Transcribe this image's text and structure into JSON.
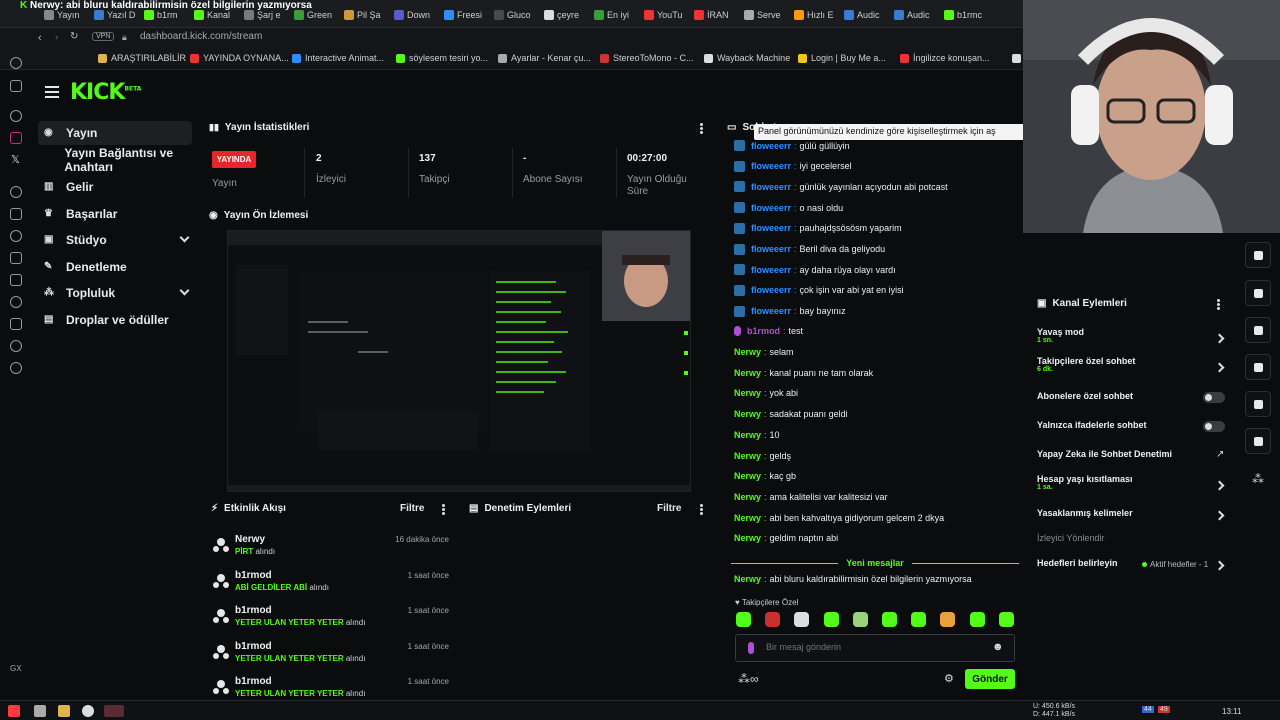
{
  "browser": {
    "window_title": "Nerwy: abi bluru kaldırabilirmisin özel bilgilerin yazmıyorsa",
    "tabs": [
      "Yayın",
      "Yazıl D",
      "b1rm",
      "Kanal",
      "Şarj e",
      "Green",
      "Pil Şa",
      "Down",
      "Freesi",
      "Gluco",
      "çeyre",
      "En iyi",
      "YouTu",
      "İRAN",
      "Serve",
      "Hızlı E",
      "Audic",
      "Audic",
      "b1rmc"
    ],
    "url": "dashboard.kick.com/stream",
    "vpn_label": "VPN",
    "bookmarks": [
      "ARAŞTIRILABİLİR",
      "YAYINDA OYNANA...",
      "Interactive Animat...",
      "söylesem tesiri yo...",
      "Ayarlar - Kenar çu...",
      "StereoToMono - C...",
      "Wayback Machine",
      "Login | Buy Me a...",
      "İngilizce konuşan...",
      "S"
    ],
    "sidebar_bottom_label": "GX"
  },
  "app": {
    "logo": "KICK",
    "logo_badge": "BETA"
  },
  "nav": {
    "items": [
      {
        "label": "Yayın",
        "icon": "stream-icon"
      },
      {
        "label": "Yayın Bağlantısı ve Anahtarı",
        "icon": "key-icon"
      },
      {
        "label": "Gelir",
        "icon": "chart-icon"
      },
      {
        "label": "Başarılar",
        "icon": "trophy-icon"
      },
      {
        "label": "Stüdyo",
        "icon": "studio-icon"
      },
      {
        "label": "Denetleme",
        "icon": "wrench-icon"
      },
      {
        "label": "Topluluk",
        "icon": "community-icon"
      },
      {
        "label": "Droplar ve ödüller",
        "icon": "gift-icon"
      }
    ]
  },
  "stats": {
    "title": "Yayın İstatistikleri",
    "live_badge": "YAYINDA",
    "live_label": "Yayın",
    "items": [
      {
        "value": "2",
        "label": "İzleyici"
      },
      {
        "value": "137",
        "label": "Takipçi"
      },
      {
        "value": "-",
        "label": "Abone Sayısı"
      },
      {
        "value": "00:27:00",
        "label": "Yayın Olduğu Süre"
      }
    ]
  },
  "preview": {
    "title": "Yayın Ön İzlemesi"
  },
  "activity": {
    "title": "Etkinlik Akışı",
    "filter": "Filtre",
    "items": [
      {
        "name": "Nerwy",
        "item": "PİRT",
        "suffix": "alındı",
        "time": "16 dakika önce"
      },
      {
        "name": "b1rmod",
        "item": "ABİ GELDİLER ABİ",
        "suffix": "alındı",
        "time": "1 saat önce"
      },
      {
        "name": "b1rmod",
        "item": "YETER ULAN YETER YETER",
        "suffix": "alındı",
        "time": "1 saat önce"
      },
      {
        "name": "b1rmod",
        "item": "YETER ULAN YETER YETER",
        "suffix": "alındı",
        "time": "1 saat önce"
      },
      {
        "name": "b1rmod",
        "item": "YETER ULAN YETER YETER",
        "suffix": "alındı",
        "time": "1 saat önce"
      }
    ]
  },
  "moderation": {
    "title": "Denetim Eylemleri",
    "filter": "Filtre"
  },
  "chat": {
    "title": "Sohbet",
    "tooltip": "Panel görünümünüzü kendinize göre kişiselleştirmek için aş",
    "messages": [
      {
        "user": "floweeerr",
        "badge": "k",
        "color": "#2d8fff",
        "text": "gülü güllüyin"
      },
      {
        "user": "floweeerr",
        "badge": "k",
        "color": "#2d8fff",
        "text": "iyi gecelersel"
      },
      {
        "user": "floweeerr",
        "badge": "k",
        "color": "#2d8fff",
        "text": "günlük yayınları açıyodun abi potcast"
      },
      {
        "user": "floweeerr",
        "badge": "k",
        "color": "#2d8fff",
        "text": "o nasi oldu"
      },
      {
        "user": "floweeerr",
        "badge": "k",
        "color": "#2d8fff",
        "text": "pauhajdşsösösm yaparim"
      },
      {
        "user": "floweeerr",
        "badge": "k",
        "color": "#2d8fff",
        "text": "Beril diva da geliyodu"
      },
      {
        "user": "floweeerr",
        "badge": "k",
        "color": "#2d8fff",
        "text": "ay daha rüya olayı vardı"
      },
      {
        "user": "floweeerr",
        "badge": "k",
        "color": "#2d8fff",
        "text": "çok işin var abi yat en iyisi"
      },
      {
        "user": "floweeerr",
        "badge": "k",
        "color": "#2d8fff",
        "text": "bay bayınız"
      },
      {
        "user": "b1rmod",
        "badge": "mic",
        "color": "#b04fd6",
        "text": "test"
      },
      {
        "user": "Nerwy",
        "badge": "",
        "color": "#53fc18",
        "text": "selam"
      },
      {
        "user": "Nerwy",
        "badge": "",
        "color": "#53fc18",
        "text": "kanal puanı ne tam olarak"
      },
      {
        "user": "Nerwy",
        "badge": "",
        "color": "#53fc18",
        "text": "yok abi"
      },
      {
        "user": "Nerwy",
        "badge": "",
        "color": "#53fc18",
        "text": "sadakat puanı geldi"
      },
      {
        "user": "Nerwy",
        "badge": "",
        "color": "#53fc18",
        "text": "10"
      },
      {
        "user": "Nerwy",
        "badge": "",
        "color": "#53fc18",
        "text": "geldş"
      },
      {
        "user": "Nerwy",
        "badge": "",
        "color": "#53fc18",
        "text": "kaç gb"
      },
      {
        "user": "Nerwy",
        "badge": "",
        "color": "#53fc18",
        "text": "ama kalitelisi var kalitesizi var"
      },
      {
        "user": "Nerwy",
        "badge": "",
        "color": "#53fc18",
        "text": "abi ben kahvaltıya gidiyorum gelcem 2 dkya"
      },
      {
        "user": "Nerwy",
        "badge": "",
        "color": "#53fc18",
        "text": "geldim naptın abi"
      }
    ],
    "new_messages_label": "Yeni mesajlar",
    "new_message": {
      "user": "Nerwy",
      "color": "#53fc18",
      "text": "abi bluru kaldırabilirmisin özel bilgilerin yazmıyorsa"
    },
    "followers_only_label": "Takipçilere Özel",
    "input_placeholder": "Bir mesaj gönderin",
    "send_label": "Gönder"
  },
  "actions": {
    "title": "Kanal Eylemleri",
    "rows": [
      {
        "label": "Yavaş mod",
        "sub": "1 sn.",
        "control": "chevron"
      },
      {
        "label": "Takipçilere özel sohbet",
        "sub": "6 dk.",
        "control": "chevron"
      },
      {
        "label": "Abonelere özel sohbet",
        "sub": "",
        "control": "toggle"
      },
      {
        "label": "Yalnızca ifadelerle sohbet",
        "sub": "",
        "control": "toggle"
      },
      {
        "label": "Yapay Zeka ile Sohbet Denetimi",
        "sub": "",
        "control": "external"
      },
      {
        "label": "Hesap yaşı kısıtlaması",
        "sub": "1 sa.",
        "control": "chevron"
      },
      {
        "label": "Yasaklanmış kelimeler",
        "sub": "",
        "control": "chevron"
      },
      {
        "label": "İzleyici Yönlendir",
        "sub": "",
        "control": "none"
      },
      {
        "label": "Hedefleri belirleyin",
        "sub": "",
        "control": "chevron"
      }
    ],
    "goals_status": "Aktif hedefler - 1"
  },
  "taskbar": {
    "net_up": "450.6 kB/s",
    "net_down": "447.1 kB/s",
    "net_up_label": "U:",
    "net_down_label": "D:",
    "badge1": "44",
    "badge2": "49",
    "clock": "13:11"
  },
  "colors": {
    "accent": "#53fc18",
    "live": "#e5262a",
    "bg": "#0b0c0e"
  }
}
